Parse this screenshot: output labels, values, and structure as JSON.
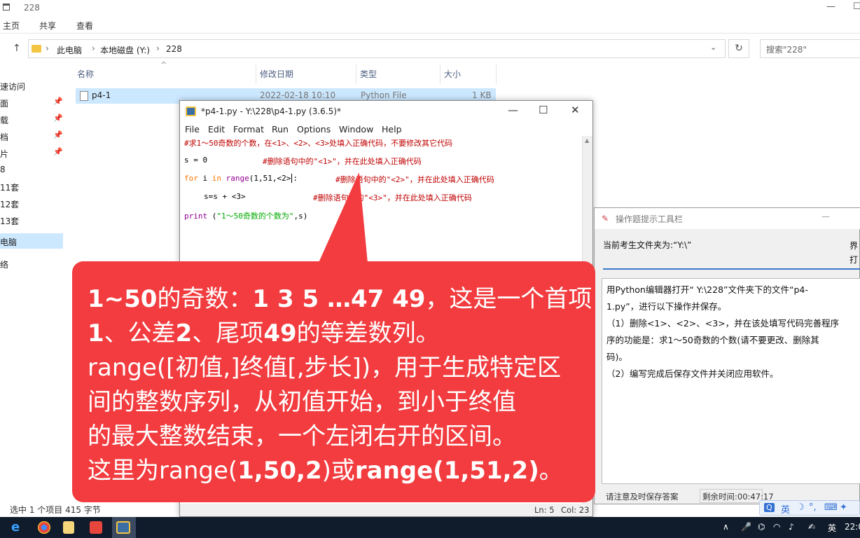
{
  "explorer": {
    "title": "228",
    "ribbon_tabs": [
      "主页",
      "共享",
      "查看"
    ],
    "breadcrumb": [
      "此电脑",
      "本地磁盘 (Y:)",
      "228"
    ],
    "search_placeholder": "搜索\"228\"",
    "sidebar": [
      "速访问",
      "面",
      "载",
      "档",
      "片",
      "8",
      "11套",
      "12套",
      "13套",
      "电脑",
      "络"
    ],
    "columns": {
      "name": "名称",
      "date": "修改日期",
      "type": "类型",
      "size": "大小"
    },
    "file": {
      "name": "p4-1",
      "date": "2022-02-18 10:10",
      "type": "Python File",
      "size": "1 KB"
    },
    "status": "选中 1 个项目  415 字节"
  },
  "idle": {
    "title": "*p4-1.py - Y:\\228\\p4-1.py (3.6.5)*",
    "menu": [
      "File",
      "Edit",
      "Format",
      "Run",
      "Options",
      "Window",
      "Help"
    ],
    "code": {
      "l1": "#求1～50奇数的个数，在<1>、<2>、<3>处填入正确代码，不要修改其它代码",
      "l2a": "s = 0",
      "l2b": "#删除语句中的\"<1>\"，并在此处填入正确代码",
      "l3kw1": "for",
      "l3a": " i ",
      "l3kw2": "in",
      "l3b": " ",
      "l3fn": "range",
      "l3c": "(1,51,<2>",
      "l3d": ":",
      "l3e": "#删除语句中的\"<2>\"，并在此处填入正确代码",
      "l4a": "s=s + <3>",
      "l4b": "#删除语句中的\"<3>\"，并在此处填入正确代码",
      "l5fn": "print",
      "l5a": " (",
      "l5str": "\"1～50奇数的个数为\"",
      "l5b": ",s)"
    },
    "status_ln": "Ln: 5",
    "status_col": "Col: 23"
  },
  "hint": {
    "title": "操作题提示工具栏",
    "current_folder": "当前考生文件夹为:“Y:\\”",
    "right_top_1": "界",
    "right_top_2": "打",
    "instructions": [
      "用Python编辑器打开“ Y:\\228”文件夹下的文件“p4-",
      "1.py”，进行以下操作并保存。",
      "（1）删除<1>、<2>、<3>，并在该处填写代码完善程序",
      "序的功能是：求1～50奇数的个数(请不要更改、删除其",
      "码)。",
      "（2）编写完成后保存文件并关闭应用软件。"
    ],
    "footer_left": "请注意及时保存答案",
    "footer_time": "剩余时间:00:47:17"
  },
  "ime": {
    "label": "英"
  },
  "callout": {
    "line1_a": "1~50",
    "line1_b": "的奇数：",
    "line1_c": "1 3 5 …47 49",
    "line1_d": "，这是一个首项",
    "line2_a": "1",
    "line2_b": "、公差",
    "line2_c": "2",
    "line2_d": "、尾项",
    "line2_e": "49",
    "line2_f": "的等差数列。",
    "line3": "range([初值,]终值[,步长])，用于生成特定区",
    "line4": "间的整数序列，从初值开始，到小于终值",
    "line5": "的最大整数结束，一个左闭右开的区间。",
    "line6_a": "这里为range(",
    "line6_b": "1,50,2",
    "line6_c": ")或",
    "line6_d": "range(1,51,2)",
    "line6_e": "。"
  },
  "taskbar": {
    "lang": "英",
    "clock": "22:0"
  }
}
